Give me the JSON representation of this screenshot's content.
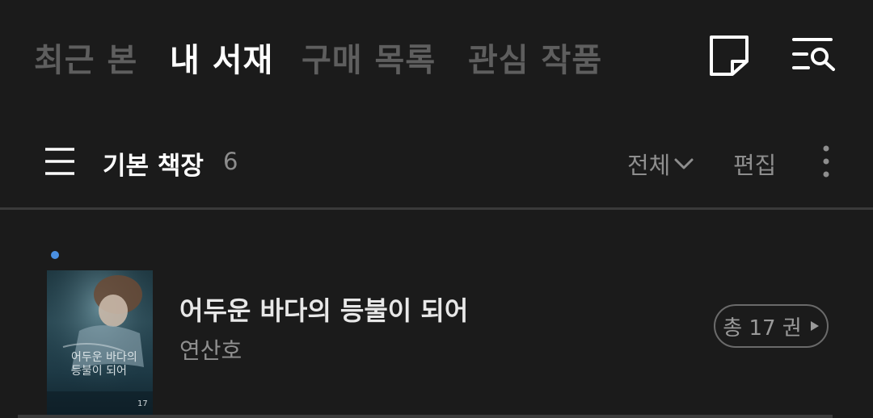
{
  "tabs": [
    {
      "label": "최근 본",
      "active": false
    },
    {
      "label": "내 서재",
      "active": true
    },
    {
      "label": "구매 목록",
      "active": false
    },
    {
      "label": "관심 작품",
      "active": false
    }
  ],
  "icons": {
    "note": "note-icon",
    "search_list": "list-search-icon",
    "menu": "hamburger-menu-icon",
    "chevron": "chevron-down-icon",
    "more": "more-vertical-icon",
    "play": "play-triangle-icon"
  },
  "shelf": {
    "title": "기본 책장",
    "count": "6",
    "filter_label": "전체",
    "edit_label": "편집"
  },
  "books": [
    {
      "title": "어두운 바다의 등불이 되어",
      "author": "연산호",
      "volumes_label": "총 17 권",
      "is_new": true,
      "cover_text": "어두운 바다의 등불이 되어",
      "cover_volume": "17"
    }
  ],
  "colors": {
    "background": "#1b1b1b",
    "active_tab": "#ffffff",
    "inactive_tab": "#5e5e5e",
    "new_dot": "#4a90e2",
    "divider": "#3a3a3a"
  }
}
